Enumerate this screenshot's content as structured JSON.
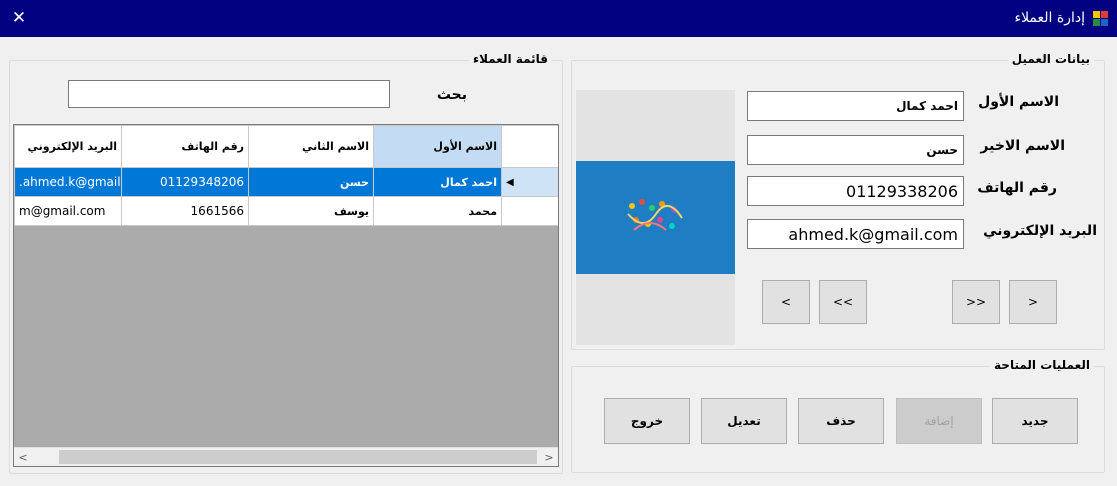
{
  "window": {
    "title": "إدارة العملاء",
    "close_glyph": "✕",
    "icon": "app-icon"
  },
  "customer_data": {
    "group_title": "بيانات العميل",
    "first_name_label": "الاسم الأول",
    "first_name_value": "احمد كمال",
    "last_name_label": "الاسم الاخير",
    "last_name_value": "حسن",
    "phone_label": "رقم الهاتف",
    "phone_value": "01129338206",
    "email_label": "البريد الإلكتروني",
    "email_value": "ahmed.k@gmail.com"
  },
  "navigation": {
    "first": "<",
    "prev": "<<",
    "next": ">>",
    "last": ">"
  },
  "operations": {
    "group_title": "العمليات المتاحة",
    "new": "جديد",
    "add": "إضافة",
    "delete": "حذف",
    "edit": "تعديل",
    "exit": "خروج"
  },
  "customers_list": {
    "group_title": "قائمة العملاء",
    "search_label": "بحث",
    "search_value": "",
    "columns": [
      "الاسم الأول",
      "الاسم الثاني",
      "رقم الهاتف",
      "البريد الإلكتروني"
    ],
    "rows": [
      {
        "first": "احمد كمال",
        "second": "حسن",
        "phone": "01129348206",
        "email": ".ahmed.k@gmail",
        "selected": true,
        "current_marker": "◀"
      },
      {
        "first": "محمد",
        "second": "يوسف",
        "phone": "1661566",
        "email": "m@gmail.com",
        "selected": false,
        "current_marker": ""
      }
    ],
    "scroll_left": "<",
    "scroll_right": ">"
  },
  "colors": {
    "title_bar": "#000080",
    "selection": "#0078d7",
    "picture_blue": "#1f7dc4",
    "grid_background": "#ababab"
  }
}
